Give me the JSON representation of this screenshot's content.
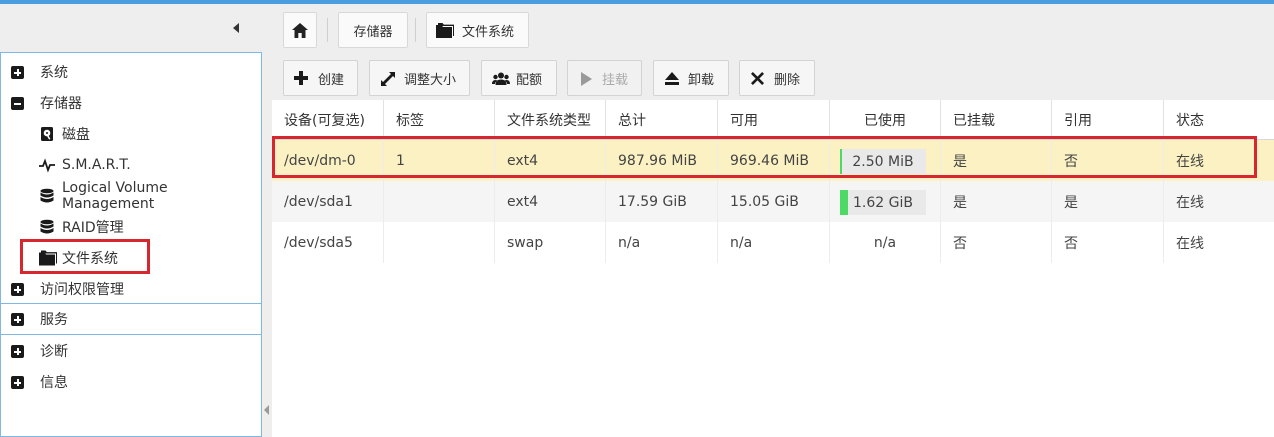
{
  "breadcrumb": {
    "storage": "存储器",
    "filesystems": "文件系统"
  },
  "sidebar": {
    "items": [
      {
        "label": "系统",
        "state": "collapsed"
      },
      {
        "label": "存储器",
        "state": "expanded"
      },
      {
        "label": "磁盘",
        "icon": "disk-icon"
      },
      {
        "label": "S.M.A.R.T.",
        "icon": "heartbeat-icon"
      },
      {
        "label": "Logical Volume Management",
        "icon": "database-icon"
      },
      {
        "label": "RAID管理",
        "icon": "database-icon"
      },
      {
        "label": "文件系统",
        "icon": "folder-icon",
        "selected": true
      },
      {
        "label": "访问权限管理",
        "state": "collapsed"
      },
      {
        "label": "服务",
        "state": "collapsed"
      },
      {
        "label": "诊断",
        "state": "collapsed"
      },
      {
        "label": "信息",
        "state": "collapsed"
      }
    ]
  },
  "toolbar": {
    "create": "创建",
    "resize": "调整大小",
    "quota": "配额",
    "mount": "挂载",
    "unmount": "卸载",
    "delete": "删除"
  },
  "table": {
    "columns": [
      "设备(可复选)",
      "标签",
      "文件系统类型",
      "总计",
      "可用",
      "已使用",
      "已挂载",
      "引用",
      "状态"
    ],
    "rows": [
      {
        "device": "/dev/dm-0",
        "label": "1",
        "type": "ext4",
        "total": "987.96 MiB",
        "available": "969.46 MiB",
        "used": "2.50 MiB",
        "used_fraction": 0.01,
        "mounted": "是",
        "referenced": "否",
        "status": "在线"
      },
      {
        "device": "/dev/sda1",
        "label": "",
        "type": "ext4",
        "total": "17.59 GiB",
        "available": "15.05 GiB",
        "used": "1.62 GiB",
        "used_fraction": 0.09,
        "mounted": "是",
        "referenced": "是",
        "status": "在线"
      },
      {
        "device": "/dev/sda5",
        "label": "",
        "type": "swap",
        "total": "n/a",
        "available": "n/a",
        "used": "n/a",
        "mounted": "否",
        "referenced": "否",
        "status": "在线"
      }
    ]
  },
  "colors": {
    "accent": "#4a9ee0",
    "selected_row": "#fcf1c3",
    "usage_fill": "#4cd964",
    "highlight": "#d7262e"
  }
}
